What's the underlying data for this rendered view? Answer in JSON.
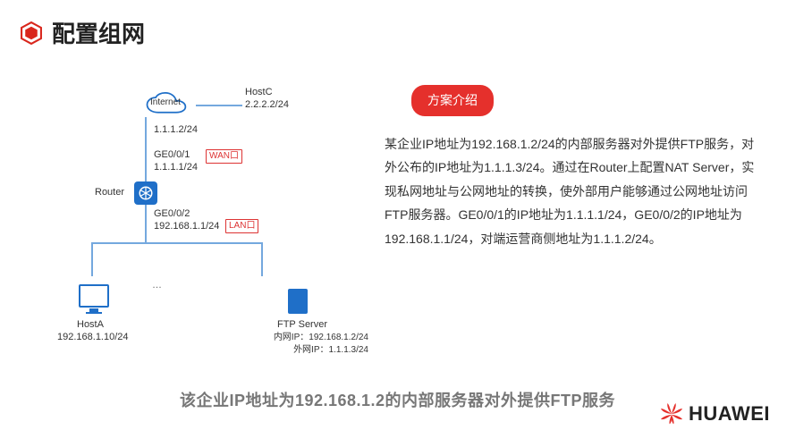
{
  "title": "配置组网",
  "pill": "方案介绍",
  "description": "某企业IP地址为192.168.1.2/24的内部服务器对外提供FTP服务，对外公布的IP地址为1.1.1.3/24。通过在Router上配置NAT Server，实现私网地址与公网地址的转换，使外部用户能够通过公网地址访问FTP服务器。GE0/0/1的IP地址为1.1.1.1/24，GE0/0/2的IP地址为192.168.1.1/24，对端运营商侧地址为1.1.1.2/24。",
  "caption": "该企业IP地址为192.168.1.2的内部服务器对外提供FTP服务",
  "logo": "HUAWEI",
  "diagram": {
    "internet": "Internet",
    "hostC": {
      "name": "HostC",
      "ip": "2.2.2.2/24"
    },
    "link_top": "1.1.1.2/24",
    "ge1": "GE0/0/1",
    "ge1_ip": "1.1.1.1/24",
    "wan": "WAN口",
    "router": "Router",
    "ge2": "GE0/0/2",
    "ge2_ip": "192.168.1.1/24",
    "lan": "LAN口",
    "hostA": {
      "name": "HostA",
      "ip": "192.168.1.10/24"
    },
    "ftp": {
      "name": "FTP Server",
      "in": "内网IP：192.168.1.2/24",
      "out": "外网IP：1.1.1.3/24"
    }
  }
}
